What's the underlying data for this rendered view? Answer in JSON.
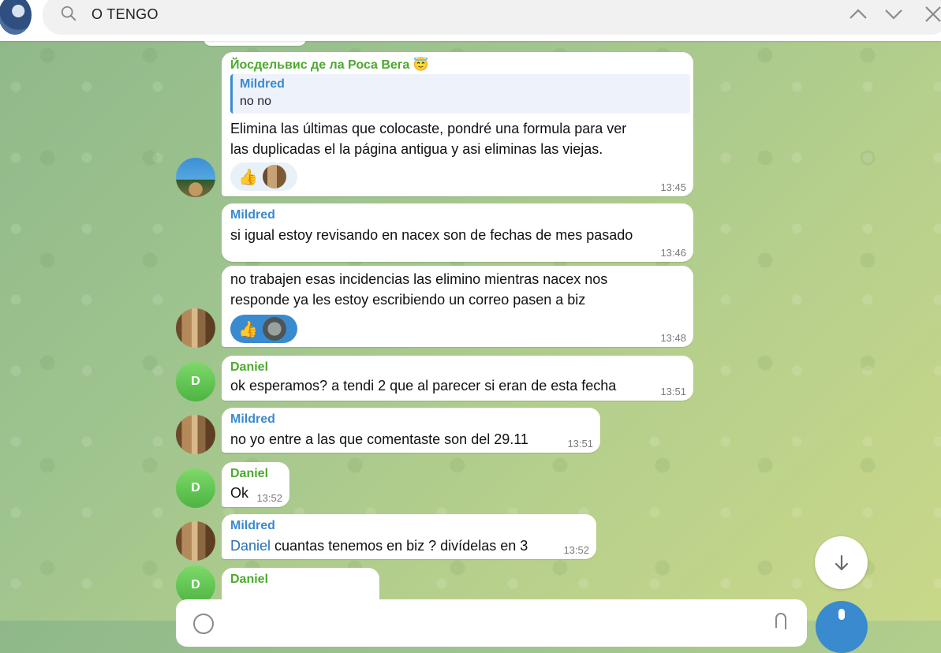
{
  "search": {
    "query": "O TENGO"
  },
  "messages": [
    {
      "sender": "Йосдельвис де ла Роса Вега 😇",
      "sender_color": "#4caa2e",
      "reply_to": {
        "name": "Mildred",
        "text": "no no"
      },
      "line1": "Elimina las últimas que colocaste, pondré una formula para ver",
      "line2": "las duplicadas el la página antigua y asi eliminas las viejas.",
      "reaction": "👍",
      "time": "13:45"
    },
    {
      "sender": "Mildred",
      "sender_color": "#3a8ad0",
      "line1": "si igual estoy revisando en nacex son de fechas de mes pasado",
      "time": "13:46"
    },
    {
      "line1": "no trabajen esas incidencias las elimino mientras nacex nos",
      "line2": "responde ya les estoy escribiendo un correo pasen a biz",
      "reaction": "👍",
      "time": "13:48"
    },
    {
      "sender": "Daniel",
      "sender_color": "#4caa2e",
      "avatar_letter": "D",
      "line1": "ok esperamos? a tendi 2 que al parecer si eran de esta fecha",
      "time": "13:51"
    },
    {
      "sender": "Mildred",
      "sender_color": "#3a8ad0",
      "line1": "no yo entre a las que comentaste son del 29.11",
      "time": "13:51"
    },
    {
      "sender": "Daniel",
      "sender_color": "#4caa2e",
      "avatar_letter": "D",
      "line1": "Ok",
      "time": "13:52"
    },
    {
      "sender": "Mildred",
      "sender_color": "#3a8ad0",
      "mention": "Daniel",
      "line1": " cuantas tenemos en biz ? divídelas en 3",
      "time": "13:52"
    },
    {
      "sender": "Daniel",
      "sender_color": "#4caa2e",
      "avatar_letter": "D"
    }
  ]
}
